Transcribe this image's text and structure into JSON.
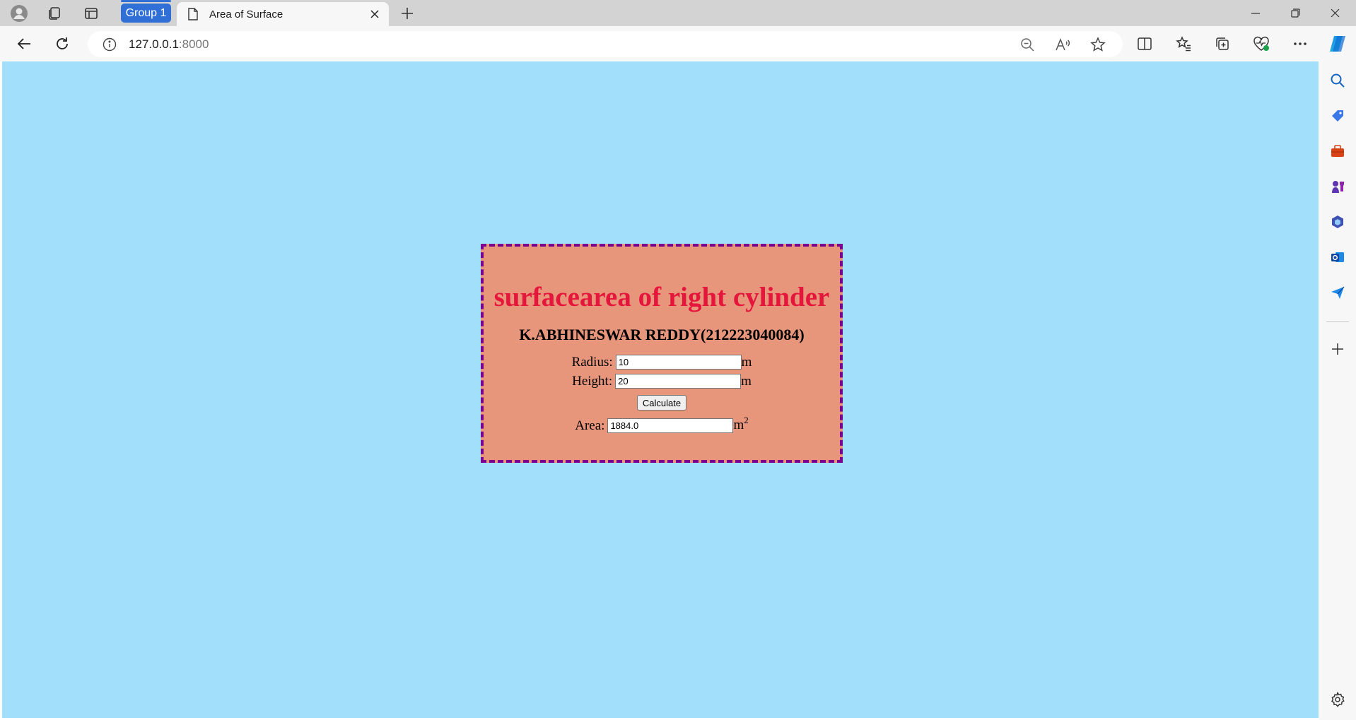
{
  "browser": {
    "tab_group_label": "Group 1",
    "tab_title": "Area of Surface",
    "address_host": "127.0.0.1",
    "address_port": ":8000"
  },
  "page": {
    "heading": "surfacearea of right cylinder",
    "author": "K.ABHINESWAR REDDY(212223040084)",
    "radius_label": "Radius:",
    "radius_value": "10",
    "radius_unit": "m",
    "height_label": "Height:",
    "height_value": "20",
    "height_unit": "m",
    "calculate_label": "Calculate",
    "area_label": "Area:",
    "area_value": "1884.0",
    "area_unit": "m",
    "area_unit_exponent": "2"
  },
  "colors": {
    "page_background": "#a2dffb",
    "card_background": "#e8967b",
    "card_border": "#7b008f",
    "heading": "#e4163c",
    "tab_group": "#2f6fd6"
  }
}
